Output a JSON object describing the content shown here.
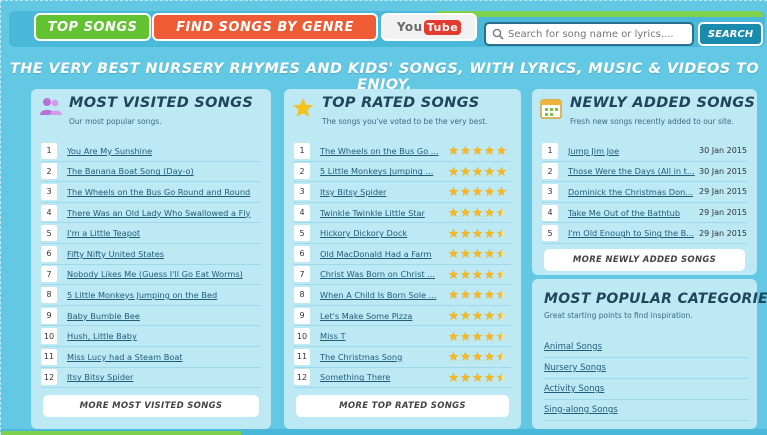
{
  "nav": {
    "top_songs": "TOP SONGS",
    "find_genre": "FIND SONGS BY GENRE",
    "yt_you": "You",
    "yt_tube": "Tube",
    "search_placeholder": "Search for song name or lyrics....",
    "search_button": "SEARCH"
  },
  "tagline": "THE VERY BEST NURSERY RHYMES AND KIDS' SONGS, WITH LYRICS, MUSIC & VIDEOS TO ENJOY.",
  "most_visited": {
    "title": "MOST VISITED SONGS",
    "subtitle": "Our most popular songs.",
    "items": [
      {
        "n": "1",
        "title": "You Are My Sunshine"
      },
      {
        "n": "2",
        "title": "The Banana Boat Song (Day-o)"
      },
      {
        "n": "3",
        "title": "The Wheels on the Bus Go Round and Round"
      },
      {
        "n": "4",
        "title": "There Was an Old Lady Who Swallowed a Fly"
      },
      {
        "n": "5",
        "title": "I'm a Little Teapot"
      },
      {
        "n": "6",
        "title": "Fifty Nifty United States"
      },
      {
        "n": "7",
        "title": "Nobody Likes Me (Guess I'll Go Eat Worms)"
      },
      {
        "n": "8",
        "title": "5 Little Monkeys Jumping on the Bed"
      },
      {
        "n": "9",
        "title": "Baby Bumble Bee"
      },
      {
        "n": "10",
        "title": "Hush, Little Baby"
      },
      {
        "n": "11",
        "title": "Miss Lucy had a Steam Boat"
      },
      {
        "n": "12",
        "title": "Itsy Bitsy Spider"
      }
    ],
    "more": "MORE MOST VISITED SONGS"
  },
  "top_rated": {
    "title": "TOP RATED SONGS",
    "subtitle": "The songs you've voted to be the very best.",
    "items": [
      {
        "n": "1",
        "title": "The Wheels on the Bus Go ...",
        "rating": 5
      },
      {
        "n": "2",
        "title": "5 Little Monkeys Jumping ...",
        "rating": 5
      },
      {
        "n": "3",
        "title": "Itsy Bitsy Spider",
        "rating": 5
      },
      {
        "n": "4",
        "title": "Twinkle Twinkle Little Star",
        "rating": 4.5
      },
      {
        "n": "5",
        "title": "Hickory Dickory Dock",
        "rating": 4.5
      },
      {
        "n": "6",
        "title": "Old MacDonald Had a Farm",
        "rating": 4.5
      },
      {
        "n": "7",
        "title": "Christ Was Born on Christ ...",
        "rating": 4.5
      },
      {
        "n": "8",
        "title": "When A Child Is Born Sole ...",
        "rating": 4.5
      },
      {
        "n": "9",
        "title": "Let's Make Some Pizza",
        "rating": 4.5
      },
      {
        "n": "10",
        "title": "Miss T",
        "rating": 4.5
      },
      {
        "n": "11",
        "title": "The Christmas Song",
        "rating": 4.5
      },
      {
        "n": "12",
        "title": "Something There",
        "rating": 4.5
      }
    ],
    "more": "MORE TOP RATED SONGS"
  },
  "newly_added": {
    "title": "NEWLY ADDED SONGS",
    "subtitle": "Fresh new songs recently added to our site.",
    "items": [
      {
        "n": "1",
        "title": "Jump Jim Joe",
        "date": "30 Jan 2015"
      },
      {
        "n": "2",
        "title": "Those Were the Days (All in t...",
        "date": "30 Jan 2015"
      },
      {
        "n": "3",
        "title": "Dominick the Christmas Don...",
        "date": "29 Jan 2015"
      },
      {
        "n": "4",
        "title": "Take Me Out of the Bathtub",
        "date": "29 Jan 2015"
      },
      {
        "n": "5",
        "title": "I'm Old Enough to Sing the B...",
        "date": "29 Jan 2015"
      }
    ],
    "more": "MORE NEWLY ADDED SONGS"
  },
  "categories": {
    "title": "MOST POPULAR CATEGORIES",
    "subtitle": "Great starting points to find inspiration.",
    "items": [
      "Animal Songs",
      "Nursery Songs",
      "Activity Songs",
      "Sing-along Songs"
    ]
  },
  "colors": {
    "background": "#62c8e4",
    "card": "#bde9f5",
    "green": "#62c232",
    "orange": "#ef5b34",
    "star": "#f5b72a"
  }
}
